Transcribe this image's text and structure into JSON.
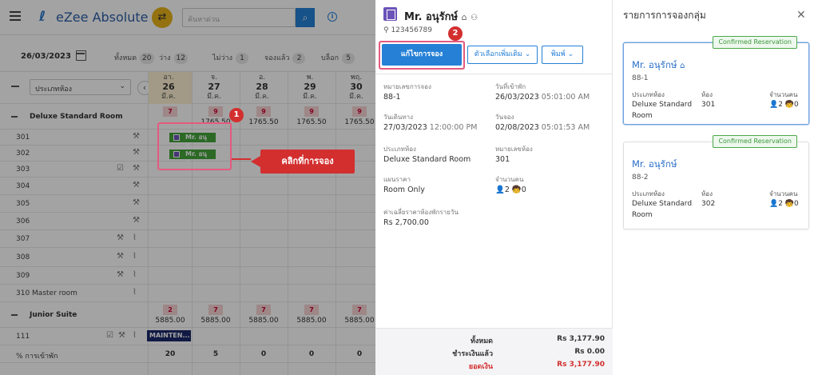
{
  "app": {
    "name": "eZee Absolute",
    "search_placeholder": "ค้นหาด่วน"
  },
  "statbar": {
    "date": "26/03/2023",
    "stats": [
      {
        "label": "ทั้งหมด",
        "count": "20"
      },
      {
        "label": "ว่าง",
        "count": "12"
      },
      {
        "label": "ไม่ว่าง",
        "count": "1"
      },
      {
        "label": "จองแล้ว",
        "count": "2"
      },
      {
        "label": "บล็อก",
        "count": "5"
      }
    ]
  },
  "grid": {
    "room_type_select": "ประเภทห้อง",
    "days": [
      {
        "dow": "อา.",
        "day": "26",
        "month": "มี.ค."
      },
      {
        "dow": "จ.",
        "day": "27",
        "month": "มี.ค."
      },
      {
        "dow": "อ.",
        "day": "28",
        "month": "มี.ค."
      },
      {
        "dow": "พ.",
        "day": "29",
        "month": "มี.ค."
      },
      {
        "dow": "พฤ.",
        "day": "30",
        "month": "มี.ค."
      }
    ],
    "groups": [
      {
        "name": "Deluxe Standard Room",
        "avail": [
          "7",
          "9",
          "9",
          "9",
          "9"
        ],
        "rates": [
          "",
          "1765.50",
          "1765.50",
          "1765.50",
          "1765.50"
        ],
        "rooms": [
          "301",
          "302",
          "303",
          "304",
          "305",
          "306",
          "307",
          "308",
          "309",
          "310 Master room"
        ]
      },
      {
        "name": "Junior Suite",
        "avail": [
          "2",
          "7",
          "7",
          "7",
          "7"
        ],
        "rates": [
          "5885.00",
          "5885.00",
          "5885.00",
          "5885.00",
          "5885.00"
        ],
        "rooms": [
          "111"
        ]
      }
    ],
    "reservations": [
      "Mr. อนุรั...",
      "Mr. อนุรั..."
    ],
    "maintenance": "MAINTEN...",
    "occupancy_label": "% การเข้าพัก",
    "occupancy": [
      "20",
      "5",
      "0",
      "0",
      "0"
    ]
  },
  "annotations": {
    "badge1": "1",
    "badge2": "2",
    "callout": "คลิกที่การจอง"
  },
  "detail": {
    "guest": "Mr. อนุรักษ์",
    "phone": "123456789",
    "edit_button": "แก้ไขการจอง",
    "more_button": "ตัวเลือกเพิ่มเติม",
    "print_button": "พิมพ์",
    "fields": {
      "res_no_label": "หมายเลขการจอง",
      "res_no": "88-1",
      "checkin_label": "วันที่เข้าพัก",
      "checkin_date": "26/03/2023",
      "checkin_time": "05:01:00 AM",
      "departure_label": "วันเดินทาง",
      "departure_date": "27/03/2023",
      "departure_time": "12:00:00 PM",
      "booking_label": "วันจอง",
      "booking_date": "02/08/2023",
      "booking_time": "05:01:53 AM",
      "room_type_label": "ประเภทห้อง",
      "room_type": "Deluxe Standard Room",
      "room_no_label": "หมายเลขห้อง",
      "room_no": "301",
      "rate_label": "แผนราคา",
      "rate": "Room Only",
      "pax_label": "จำนวนคน",
      "adults": "2",
      "children": "0",
      "avg_label": "ค่าเฉลี่ยราคาห้องพักรายวัน",
      "avg": "Rs 2,700.00"
    },
    "totals": {
      "total_label": "ทั้งหมด",
      "total": "Rs 3,177.90",
      "paid_label": "ชำระเงินแล้ว",
      "paid": "Rs 0.00",
      "balance_label": "ยอดเงิน",
      "balance": "Rs 3,177.90"
    }
  },
  "group": {
    "title": "รายการการจองกลุ่ม",
    "labels": {
      "room_type": "ประเภทห้อง",
      "room": "ห้อง",
      "pax": "จำนวนคน"
    },
    "cards": [
      {
        "status": "Confirmed Reservation",
        "name": "Mr. อนุรักษ์",
        "code": "88-1",
        "room_type_1": "Deluxe Standard",
        "room_type_2": "Room",
        "room": "301",
        "adults": "2",
        "children": "0"
      },
      {
        "status": "Confirmed Reservation",
        "name": "Mr. อนุรักษ์",
        "code": "88-2",
        "room_type_1": "Deluxe Standard",
        "room_type_2": "Room",
        "room": "302",
        "adults": "2",
        "children": "0"
      }
    ]
  },
  "colors": {
    "accent": "#2580d6",
    "annotation": "#d32f2f",
    "confirmed": "#3a983a",
    "reservation_bar": "#44a53a"
  }
}
